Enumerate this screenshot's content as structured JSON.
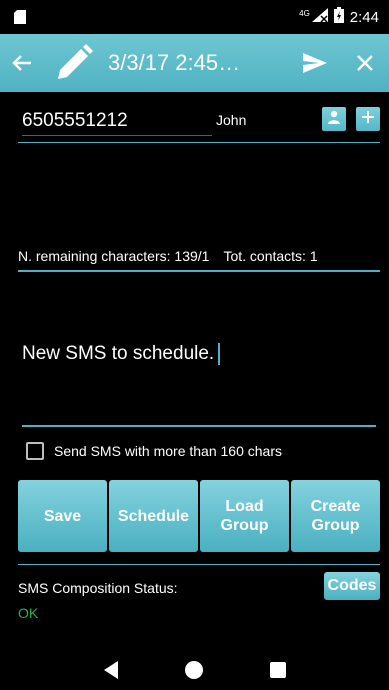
{
  "status_bar": {
    "network_label": "4G",
    "time": "2:44"
  },
  "toolbar": {
    "title": "3/3/17 2:45…",
    "icons": [
      "back-arrow-icon",
      "pencil-icon",
      "send-icon",
      "close-icon"
    ]
  },
  "contact": {
    "phone_value": "6505551212",
    "name": "John"
  },
  "info": {
    "remaining_label": "N. remaining characters:",
    "remaining_value": "139/1",
    "contacts_label": "Tot. contacts:",
    "contacts_value": "1"
  },
  "message": {
    "text": "New SMS to schedule."
  },
  "checkbox": {
    "label": "Send SMS with more than 160 chars",
    "checked": false
  },
  "buttons": {
    "save": "Save",
    "schedule": "Schedule",
    "load_group": "Load\nGroup",
    "create_group": "Create\nGroup"
  },
  "composition": {
    "label": "SMS Composition Status:",
    "value": "OK",
    "codes_button": "Codes"
  },
  "colors": {
    "accent": "#4fb2c2",
    "status_ok": "#2bb24c",
    "background": "#000000"
  }
}
